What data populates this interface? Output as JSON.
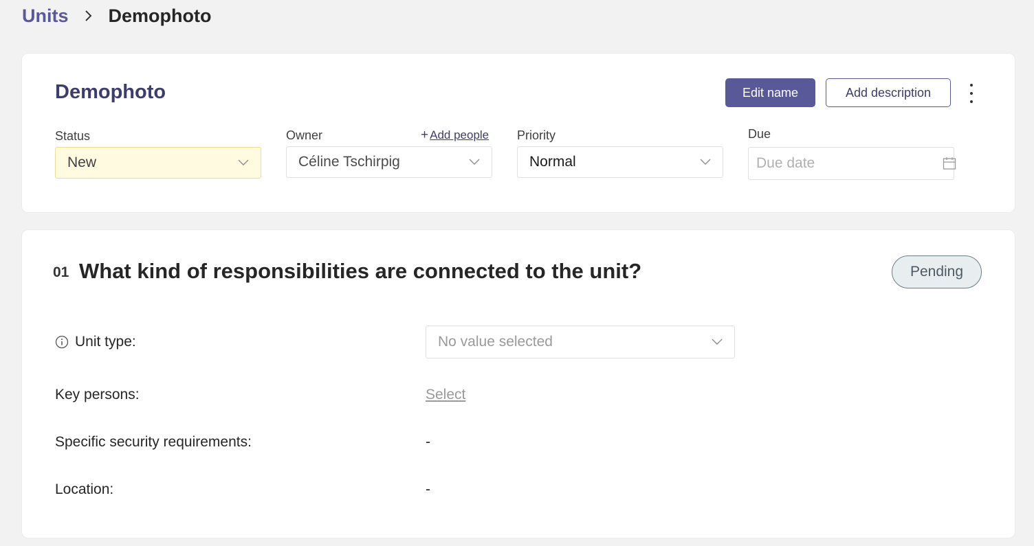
{
  "breadcrumb": {
    "parent": "Units",
    "current": "Demophoto"
  },
  "unit": {
    "title": "Demophoto",
    "edit_name_label": "Edit name",
    "add_description_label": "Add description"
  },
  "fields": {
    "status": {
      "label": "Status",
      "value": "New"
    },
    "owner": {
      "label": "Owner",
      "value": "Céline Tschirpig",
      "add_people": "Add people",
      "add_symbol": "+"
    },
    "priority": {
      "label": "Priority",
      "value": "Normal"
    },
    "due": {
      "label": "Due",
      "placeholder": "Due date",
      "value": ""
    }
  },
  "question": {
    "number": "01",
    "text": "What kind of responsibilities are connected to the unit?",
    "status": "Pending",
    "rows": {
      "unit_type": {
        "label": "Unit type:",
        "value": "No value selected"
      },
      "key_persons": {
        "label": "Key persons:",
        "value": "Select"
      },
      "security": {
        "label": "Specific security requirements:",
        "value": "-"
      },
      "location": {
        "label": "Location:",
        "value": "-"
      }
    }
  },
  "colors": {
    "accent": "#59599a",
    "title": "#3d3d6b",
    "status_bg": "#fffae0",
    "badge_bg": "#e8eef0"
  },
  "icons": {
    "breadcrumb_separator": "chevron-right-icon",
    "menu": "kebab-menu-icon",
    "dropdown": "chevron-down-icon",
    "calendar": "calendar-icon",
    "info": "info-icon"
  }
}
